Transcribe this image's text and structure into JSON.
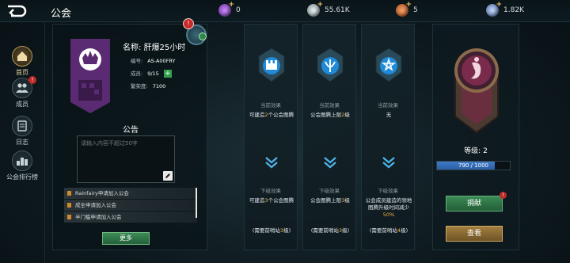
{
  "header": {
    "title": "公会",
    "resources": [
      {
        "icon": "purple-gem-icon",
        "value": "0",
        "color": "#9b54d6"
      },
      {
        "icon": "silver-coin-icon",
        "value": "55.61K",
        "color": "#b9c2c6"
      },
      {
        "icon": "gold-orb-icon",
        "value": "5",
        "color": "#d46a2a"
      },
      {
        "icon": "blue-crystal-icon",
        "value": "1.82K",
        "color": "#7fa0d8"
      }
    ]
  },
  "sidebar": {
    "items": [
      {
        "label": "首页",
        "icon": "home-icon",
        "active": true
      },
      {
        "label": "成员",
        "icon": "members-icon",
        "badge": "!"
      },
      {
        "label": "日志",
        "icon": "log-icon"
      },
      {
        "label": "公会排行榜",
        "icon": "ranking-icon"
      }
    ]
  },
  "guild": {
    "name_prefix": "名称:",
    "name": "肝爆25小时",
    "id_label": "编号:",
    "id": "AS-A00FRY",
    "members_label": "成员:",
    "members": "9/15",
    "prosperity_label": "繁荣度:",
    "prosperity": "7100",
    "avatar_badge": "!"
  },
  "notice": {
    "title": "公告",
    "placeholder": "请输入内容不超过50字"
  },
  "logs": [
    "Rainfairy申请加入公会",
    "成全申请加入公会",
    "半门槛申请加入公会"
  ],
  "more_label": "更多",
  "columns": [
    {
      "icon": "castle-icon",
      "current_label": "当前效果",
      "current_pre": "可建造",
      "current_num": "2",
      "current_post": "个公会图腾",
      "next_label": "下级效果",
      "next_pre": "可建造",
      "next_num": "3",
      "next_post": "个公会图腾",
      "req_pre": "(需要前哨站",
      "req_num": "3",
      "req_post": "级)"
    },
    {
      "icon": "rune-icon",
      "current_label": "当前效果",
      "current_pre": "公会图腾上限",
      "current_num": "2",
      "current_post": "级",
      "next_label": "下级效果",
      "next_pre": "公会图腾上限",
      "next_num": "3",
      "next_post": "级",
      "req_pre": "(需要前哨站",
      "req_num": "3",
      "req_post": "级)"
    },
    {
      "icon": "star-sigil-icon",
      "current_label": "当前效果",
      "current_pre": "无",
      "current_num": "",
      "current_post": "",
      "next_label": "下级效果",
      "next_pre": "公会成员建造的领地图腾升级时间减少",
      "next_num": "50%",
      "next_post": "",
      "req_pre": "(需要前哨站",
      "req_num": "4",
      "req_post": "级)"
    }
  ],
  "level": {
    "label": "等级:",
    "value": "2",
    "exp_text": "790 / 1000",
    "exp_fraction": 0.79,
    "donate_label": "捐献",
    "donate_badge": "!",
    "view_label": "查看"
  }
}
